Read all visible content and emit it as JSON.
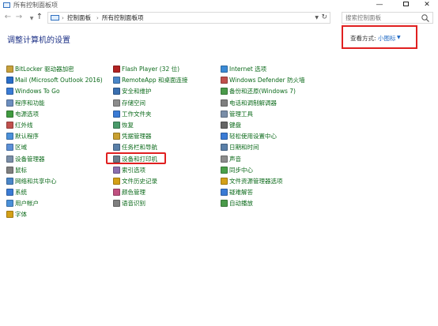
{
  "window": {
    "title": "所有控制面板项"
  },
  "address": {
    "crumbs": [
      "控制面板",
      "所有控制面板项"
    ]
  },
  "search": {
    "placeholder": "搜索控制面板"
  },
  "header": {
    "title": "调整计算机的设置",
    "view_by_label": "查看方式:",
    "view_by_value": "小图标"
  },
  "columns": [
    [
      {
        "label": "BitLocker 驱动器加密",
        "icon": "bitlocker-icon",
        "color": "#c8a03a"
      },
      {
        "label": "Mail (Microsoft Outlook 2016)",
        "icon": "mail-icon",
        "color": "#2a6ec9"
      },
      {
        "label": "Windows To Go",
        "icon": "windows-to-go-icon",
        "color": "#3a7bd5"
      },
      {
        "label": "程序和功能",
        "icon": "programs-icon",
        "color": "#6c8ebf"
      },
      {
        "label": "电源选项",
        "icon": "power-icon",
        "color": "#3f9a3f"
      },
      {
        "label": "红外线",
        "icon": "infrared-icon",
        "color": "#c0504d"
      },
      {
        "label": "默认程序",
        "icon": "default-programs-icon",
        "color": "#4a90d9"
      },
      {
        "label": "区域",
        "icon": "region-icon",
        "color": "#5b8fd6"
      },
      {
        "label": "设备管理器",
        "icon": "device-manager-icon",
        "color": "#7a8ea8"
      },
      {
        "label": "鼠标",
        "icon": "mouse-icon",
        "color": "#7f7f7f"
      },
      {
        "label": "网络和共享中心",
        "icon": "network-icon",
        "color": "#4a86c8"
      },
      {
        "label": "系统",
        "icon": "system-icon",
        "color": "#3a7bd5"
      },
      {
        "label": "用户帐户",
        "icon": "user-accounts-icon",
        "color": "#4a90d9"
      },
      {
        "label": "字体",
        "icon": "fonts-icon",
        "color": "#d4a017"
      }
    ],
    [
      {
        "label": "Flash Player (32 位)",
        "icon": "flash-icon",
        "color": "#b22222"
      },
      {
        "label": "RemoteApp 和桌面连接",
        "icon": "remoteapp-icon",
        "color": "#4a86c8"
      },
      {
        "label": "安全和维护",
        "icon": "security-icon",
        "color": "#3a6fb0"
      },
      {
        "label": "存储空间",
        "icon": "storage-icon",
        "color": "#8c8c8c"
      },
      {
        "label": "工作文件夹",
        "icon": "work-folders-icon",
        "color": "#3a7bd5"
      },
      {
        "label": "恢复",
        "icon": "recovery-icon",
        "color": "#4a9a6a"
      },
      {
        "label": "凭据管理器",
        "icon": "credential-icon",
        "color": "#c9a030"
      },
      {
        "label": "任务栏和导航",
        "icon": "taskbar-icon",
        "color": "#5a7fa8"
      },
      {
        "label": "设备和打印机",
        "icon": "printer-icon",
        "color": "#6a7a8a"
      },
      {
        "label": "索引选项",
        "icon": "indexing-icon",
        "color": "#8a6fb0"
      },
      {
        "label": "文件历史记录",
        "icon": "file-history-icon",
        "color": "#d4a017"
      },
      {
        "label": "颜色管理",
        "icon": "color-icon",
        "color": "#c05080"
      },
      {
        "label": "语音识别",
        "icon": "speech-icon",
        "color": "#7f7f7f"
      }
    ],
    [
      {
        "label": "Internet 选项",
        "icon": "internet-icon",
        "color": "#3a8ad5"
      },
      {
        "label": "Windows Defender 防火墙",
        "icon": "firewall-icon",
        "color": "#c0504d"
      },
      {
        "label": "备份和还原(Windows 7)",
        "icon": "backup-icon",
        "color": "#4a9a4a"
      },
      {
        "label": "电话和调制解调器",
        "icon": "phone-icon",
        "color": "#7f7f7f"
      },
      {
        "label": "管理工具",
        "icon": "admin-tools-icon",
        "color": "#7a8ea8"
      },
      {
        "label": "键盘",
        "icon": "keyboard-icon",
        "color": "#666666"
      },
      {
        "label": "轻松使用设置中心",
        "icon": "ease-of-access-icon",
        "color": "#3a7bd5"
      },
      {
        "label": "日期和时间",
        "icon": "clock-icon",
        "color": "#5a7fa8"
      },
      {
        "label": "声音",
        "icon": "sound-icon",
        "color": "#8c8c8c"
      },
      {
        "label": "同步中心",
        "icon": "sync-icon",
        "color": "#4aa04a"
      },
      {
        "label": "文件资源管理器选项",
        "icon": "folder-options-icon",
        "color": "#d4a017"
      },
      {
        "label": "疑难解答",
        "icon": "troubleshoot-icon",
        "color": "#3a7bd5"
      },
      {
        "label": "自动播放",
        "icon": "autoplay-icon",
        "color": "#4a9a4a"
      }
    ]
  ]
}
